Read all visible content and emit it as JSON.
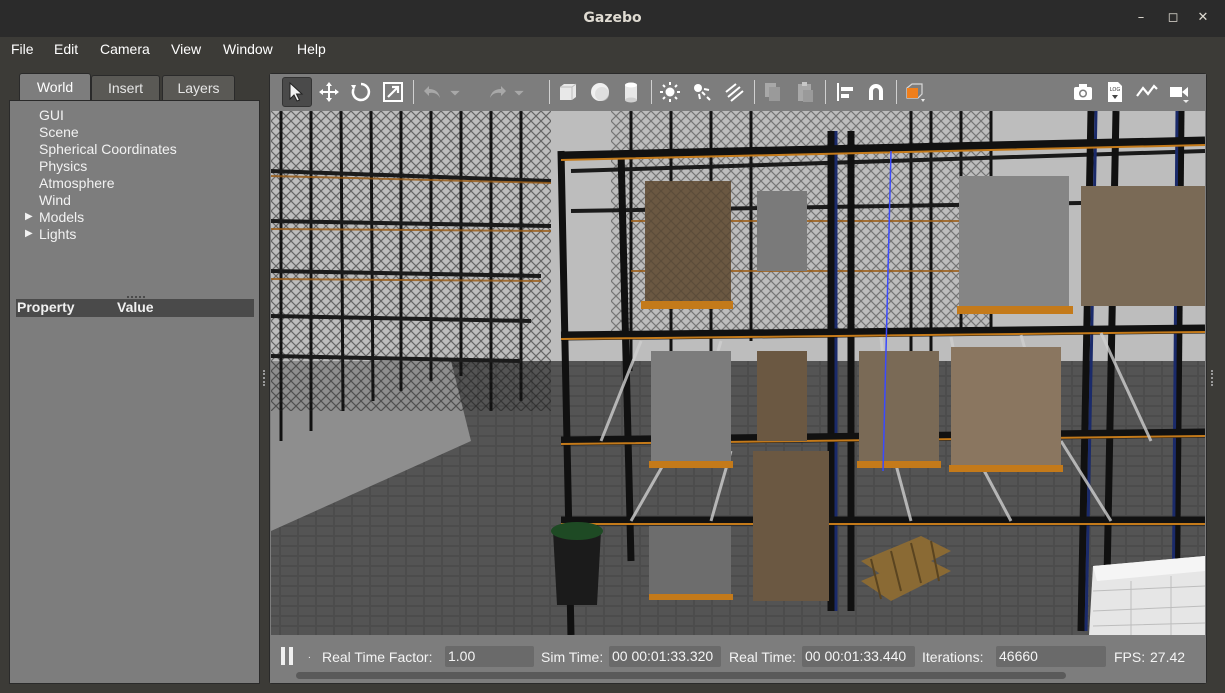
{
  "window": {
    "title": "Gazebo",
    "controls": [
      "minimize",
      "maximize",
      "close"
    ]
  },
  "menu": [
    "File",
    "Edit",
    "Camera",
    "View",
    "Window",
    "Help"
  ],
  "left_panel": {
    "tabs": [
      "World",
      "Insert",
      "Layers"
    ],
    "active_tab": "World",
    "tree": [
      {
        "label": "GUI",
        "expandable": false
      },
      {
        "label": "Scene",
        "expandable": false
      },
      {
        "label": "Spherical Coordinates",
        "expandable": false
      },
      {
        "label": "Physics",
        "expandable": false
      },
      {
        "label": "Atmosphere",
        "expandable": false
      },
      {
        "label": "Wind",
        "expandable": false
      },
      {
        "label": "Models",
        "expandable": true
      },
      {
        "label": "Lights",
        "expandable": true
      }
    ],
    "property_header": {
      "property": "Property",
      "value": "Value"
    }
  },
  "toolbar": {
    "tools": [
      "select-mode-icon",
      "translate-mode-icon",
      "rotate-mode-icon",
      "scale-mode-icon",
      "undo-icon",
      "undo-dropdown-icon",
      "redo-icon",
      "redo-dropdown-icon",
      "box-shape-icon",
      "sphere-shape-icon",
      "cylinder-shape-icon",
      "point-light-icon",
      "spot-light-icon",
      "directional-light-icon",
      "copy-icon",
      "paste-icon",
      "align-icon",
      "snap-icon",
      "view-angle-icon",
      "screenshot-icon",
      "log-icon",
      "plot-icon",
      "video-record-icon"
    ],
    "active_tool": "select-mode-icon",
    "accent_color": "#f07f1c"
  },
  "status": {
    "paused": true,
    "real_time_factor_label": "Real Time Factor:",
    "real_time_factor": "1.00",
    "sim_time_label": "Sim Time:",
    "sim_time": "00 00:01:33.320",
    "real_time_label": "Real Time:",
    "real_time": "00 00:01:33.440",
    "iterations_label": "Iterations:",
    "iterations": "46660",
    "fps_label": "FPS:",
    "fps": "27.42"
  },
  "colors": {
    "titlebar": "#2b2b2b",
    "background": "#3c3b37",
    "panel": "#7d7d7d",
    "header": "#4a4a4a"
  }
}
